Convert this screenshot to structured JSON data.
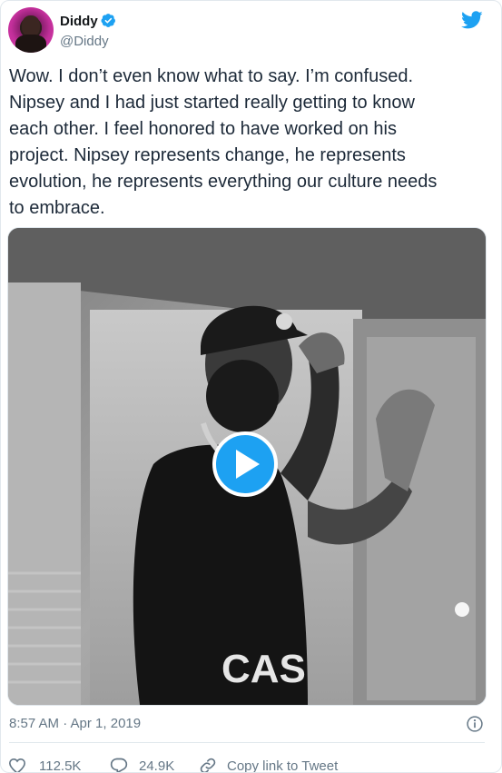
{
  "author": {
    "name": "Diddy",
    "handle": "@Diddy",
    "verified": true
  },
  "tweet": {
    "text": "Wow. I don’t even know what to say. I’m confused.\nNipsey and I had just started really getting to know\neach other. I feel honored to have worked on his\nproject. Nipsey represents change, he represents\nevolution, he represents everything our culture needs\nto embrace.",
    "timestamp": "8:57 AM · Apr 1, 2019",
    "media": {
      "type": "video",
      "overlay_text": "CAS"
    }
  },
  "actions": {
    "likes": "112.5K",
    "replies": "24.9K",
    "copy_link_label": "Copy link to Tweet"
  },
  "colors": {
    "accent": "#1da1f2",
    "like": "#e0245e",
    "muted": "#657786"
  },
  "icons": [
    "twitter-bird-icon",
    "verified-badge-icon",
    "play-icon",
    "info-icon",
    "heart-icon",
    "reply-icon",
    "link-icon"
  ]
}
